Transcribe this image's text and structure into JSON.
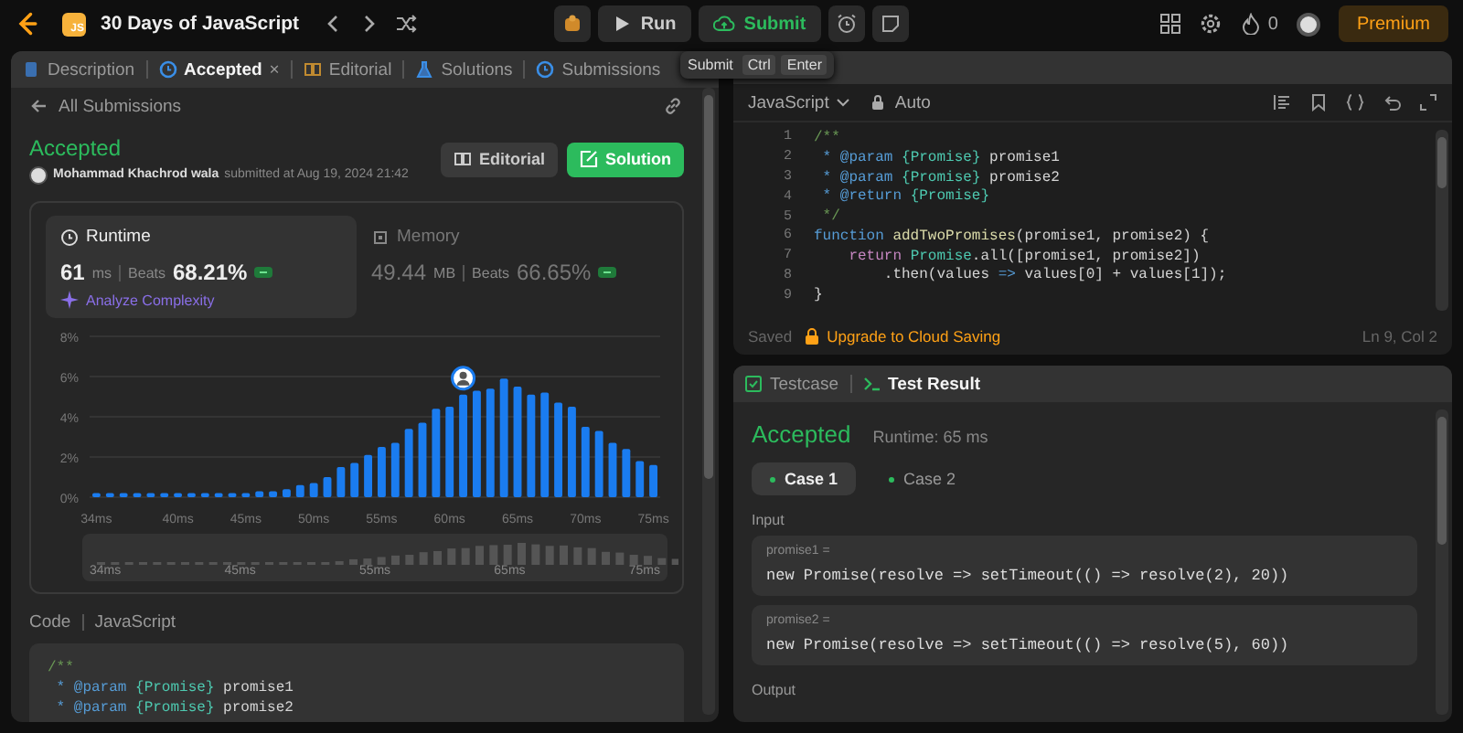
{
  "top_bar": {
    "badge": "JS",
    "title": "30 Days of JavaScript",
    "run": "Run",
    "submit": "Submit",
    "streak": "0",
    "premium": "Premium"
  },
  "tooltip": {
    "label": "Submit",
    "keys": [
      "Ctrl",
      "Enter"
    ]
  },
  "left_tabs": [
    {
      "label": "Description",
      "kind": "description",
      "selected": false
    },
    {
      "label": "Accepted",
      "kind": "submission",
      "selected": true,
      "close": "×"
    },
    {
      "label": "Editorial",
      "kind": "editorial",
      "selected": false
    },
    {
      "label": "Solutions",
      "kind": "solutions",
      "selected": false
    },
    {
      "label": "Submissions",
      "kind": "submissions",
      "selected": false
    }
  ],
  "back_link": "All Submissions",
  "submission": {
    "status": "Accepted",
    "author": "Mohammad Khachrod wala",
    "submitted": "submitted at Aug 19, 2024 21:42",
    "buttons": [
      {
        "label": "Editorial",
        "kind": "editorial"
      },
      {
        "label": "Solution",
        "kind": "solution"
      }
    ]
  },
  "performance": {
    "metrics": [
      {
        "title": "Runtime",
        "kind": "runtime",
        "value": "61",
        "unit": "ms",
        "beats_label": "Beats",
        "beats": "68.21%",
        "selected": true,
        "link": "Analyze Complexity"
      },
      {
        "title": "Memory",
        "kind": "memory",
        "value": "49.44",
        "unit": "MB",
        "beats_label": "Beats",
        "beats": "66.65%",
        "selected": false
      }
    ],
    "chart_data": {
      "type": "bar",
      "x": [
        34,
        35,
        36,
        37,
        38,
        39,
        40,
        41,
        42,
        43,
        44,
        45,
        46,
        47,
        48,
        49,
        50,
        51,
        52,
        53,
        54,
        55,
        56,
        57,
        58,
        59,
        60,
        61,
        62,
        63,
        64,
        65,
        66,
        67,
        68,
        69,
        70,
        71,
        72,
        73,
        74,
        75
      ],
      "values": [
        0.2,
        0.2,
        0.2,
        0.2,
        0.2,
        0.2,
        0.2,
        0.2,
        0.2,
        0.2,
        0.2,
        0.2,
        0.3,
        0.3,
        0.4,
        0.6,
        0.7,
        1.0,
        1.5,
        1.7,
        2.1,
        2.5,
        2.7,
        3.4,
        3.7,
        4.4,
        4.5,
        5.1,
        5.3,
        5.4,
        5.9,
        5.5,
        5.1,
        5.2,
        4.7,
        4.5,
        3.5,
        3.3,
        2.7,
        2.4,
        1.8,
        1.6
      ],
      "xlim": [
        33.5,
        75.5
      ],
      "ylim": [
        0,
        8
      ],
      "grid": true,
      "xticks": [
        {
          "value": 34,
          "label": "34ms"
        },
        {
          "value": 40,
          "label": "40ms"
        },
        {
          "value": 45,
          "label": "45ms"
        },
        {
          "value": 50,
          "label": "50ms"
        },
        {
          "value": 55,
          "label": "55ms"
        },
        {
          "value": 60,
          "label": "60ms"
        },
        {
          "value": 65,
          "label": "65ms"
        },
        {
          "value": 70,
          "label": "70ms"
        },
        {
          "value": 75,
          "label": "75ms"
        }
      ],
      "yticks": [
        {
          "value": 0,
          "label": "0%"
        },
        {
          "value": 2,
          "label": "2%"
        },
        {
          "value": 4,
          "label": "4%"
        },
        {
          "value": 6,
          "label": "6%"
        },
        {
          "value": 8,
          "label": "8%"
        }
      ]
    },
    "range_labels": [
      "34ms",
      "45ms",
      "55ms",
      "65ms",
      "75ms"
    ]
  },
  "code_header": {
    "label": "Code",
    "language": "JavaScript"
  },
  "submitted_code": [
    {
      "tokens": [
        {
          "t": "/**",
          "color": "#6a9955"
        }
      ]
    },
    {
      "tokens": [
        {
          "t": " * @param",
          "color": "#569cd6"
        },
        {
          "t": " {Promise}",
          "color": "#4ec9b0"
        },
        {
          "t": " promise1",
          "color": "#d4d4d4"
        }
      ]
    },
    {
      "tokens": [
        {
          "t": " * @param",
          "color": "#569cd6"
        },
        {
          "t": " {Promise}",
          "color": "#4ec9b0"
        },
        {
          "t": " promise2",
          "color": "#d4d4d4"
        }
      ]
    }
  ],
  "editor": {
    "language": "JavaScript",
    "mode": "Auto",
    "saved": "Saved",
    "upgrade": "Upgrade to Cloud Saving",
    "position": "Ln 9, Col 2",
    "lines": [
      {
        "n": "1",
        "tokens": [
          {
            "t": "/**",
            "color": "#6a9955"
          }
        ]
      },
      {
        "n": "2",
        "tokens": [
          {
            "t": " * @param",
            "color": "#569cd6"
          },
          {
            "t": " {Promise}",
            "color": "#4ec9b0"
          },
          {
            "t": " promise1",
            "color": "#d4d4d4"
          }
        ]
      },
      {
        "n": "3",
        "tokens": [
          {
            "t": " * @param",
            "color": "#569cd6"
          },
          {
            "t": " {Promise}",
            "color": "#4ec9b0"
          },
          {
            "t": " promise2",
            "color": "#d4d4d4"
          }
        ]
      },
      {
        "n": "4",
        "tokens": [
          {
            "t": " * @return",
            "color": "#569cd6"
          },
          {
            "t": " {Promise}",
            "color": "#4ec9b0"
          }
        ]
      },
      {
        "n": "5",
        "tokens": [
          {
            "t": " */",
            "color": "#6a9955"
          }
        ]
      },
      {
        "n": "6",
        "tokens": [
          {
            "t": "function",
            "color": "#569cd6"
          },
          {
            "t": " addTwoPromises",
            "color": "#dcdcaa"
          },
          {
            "t": "(promise1, promise2) {",
            "color": "#d4d4d4"
          }
        ]
      },
      {
        "n": "7",
        "tokens": [
          {
            "t": "    return",
            "color": "#c586c0"
          },
          {
            "t": " Promise",
            "color": "#4ec9b0"
          },
          {
            "t": ".all([promise1, promise2])",
            "color": "#d4d4d4"
          }
        ]
      },
      {
        "n": "8",
        "tokens": [
          {
            "t": "        .then(values ",
            "color": "#d4d4d4"
          },
          {
            "t": "=>",
            "color": "#569cd6"
          },
          {
            "t": " values[0] + values[1]);",
            "color": "#d4d4d4"
          }
        ]
      },
      {
        "n": "9",
        "tokens": [
          {
            "t": "}",
            "color": "#d4d4d4"
          }
        ]
      }
    ]
  },
  "bottom_tabs": [
    {
      "label": "Testcase",
      "kind": "testcase",
      "selected": false
    },
    {
      "label": "Test Result",
      "kind": "result",
      "selected": true
    }
  ],
  "result": {
    "status": "Accepted",
    "runtime": "Runtime: 65 ms",
    "cases": [
      {
        "label": "Case 1",
        "selected": true
      },
      {
        "label": "Case 2",
        "selected": false
      }
    ],
    "input_label": "Input",
    "inputs": [
      {
        "name": "promise1 =",
        "value": "new Promise(resolve => setTimeout(() => resolve(2), 20))"
      },
      {
        "name": "promise2 =",
        "value": "new Promise(resolve => setTimeout(() => resolve(5), 60))"
      }
    ],
    "output_label": "Output"
  }
}
